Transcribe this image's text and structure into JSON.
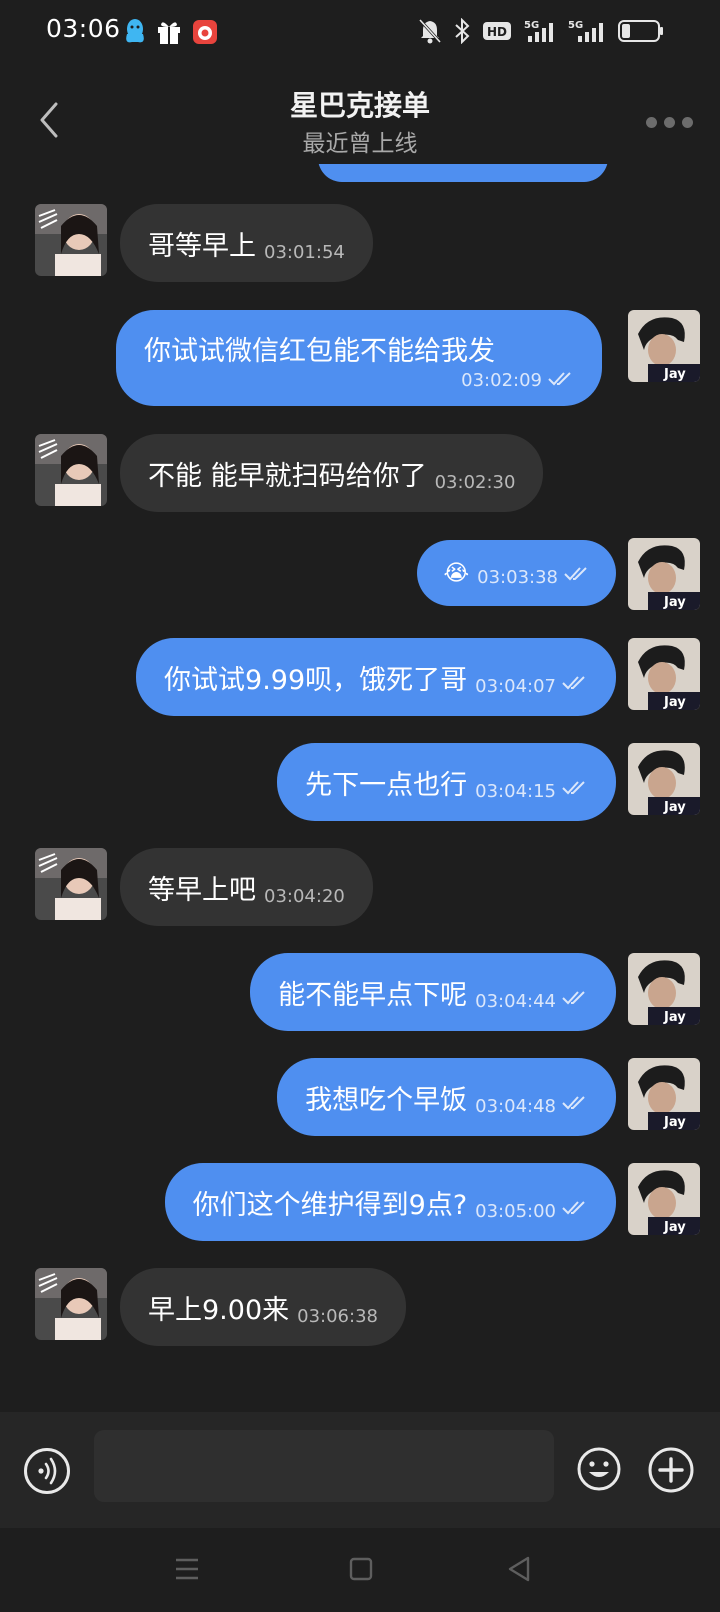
{
  "status_bar": {
    "time": "03:06",
    "left_icons": [
      "qq-icon",
      "gift-icon",
      "app-badge-icon"
    ],
    "right_icons": [
      "mute-bell-icon",
      "bluetooth-icon",
      "hd-icon",
      "signal-5g-icon",
      "signal-5g-icon-2",
      "battery-icon"
    ],
    "hd_label": "HD",
    "net_label_1": "5G",
    "net_label_2": "5G"
  },
  "header": {
    "title": "星巴克接单",
    "subtitle": "最近曾上线"
  },
  "messages": [
    {
      "side": "in",
      "text": "哥等早上",
      "time": "03:01:54"
    },
    {
      "side": "out",
      "text": "你试试微信红包能不能给我发",
      "time": "03:02:09",
      "read": true
    },
    {
      "side": "in",
      "text": "不能 能早就扫码给你了",
      "time": "03:02:30"
    },
    {
      "side": "out",
      "text": "😭",
      "time": "03:03:38",
      "read": true
    },
    {
      "side": "out",
      "text": "你试试9.99呗，饿死了哥",
      "time": "03:04:07",
      "read": true
    },
    {
      "side": "out",
      "text": "先下一点也行",
      "time": "03:04:15",
      "read": true
    },
    {
      "side": "in",
      "text": "等早上吧",
      "time": "03:04:20"
    },
    {
      "side": "out",
      "text": "能不能早点下呢",
      "time": "03:04:44",
      "read": true
    },
    {
      "side": "out",
      "text": "我想吃个早饭",
      "time": "03:04:48",
      "read": true
    },
    {
      "side": "out",
      "text": "你们这个维护得到9点?",
      "time": "03:05:00",
      "read": true
    },
    {
      "side": "in",
      "text": "早上9.00来",
      "time": "03:06:38"
    }
  ],
  "avatars": {
    "contact": "contact-avatar",
    "me_label": "Jay"
  },
  "input": {
    "value": "",
    "placeholder": ""
  },
  "colors": {
    "background": "#1e1e1e",
    "incoming_bubble": "#333333",
    "outgoing_bubble": "#4f8ff0"
  }
}
